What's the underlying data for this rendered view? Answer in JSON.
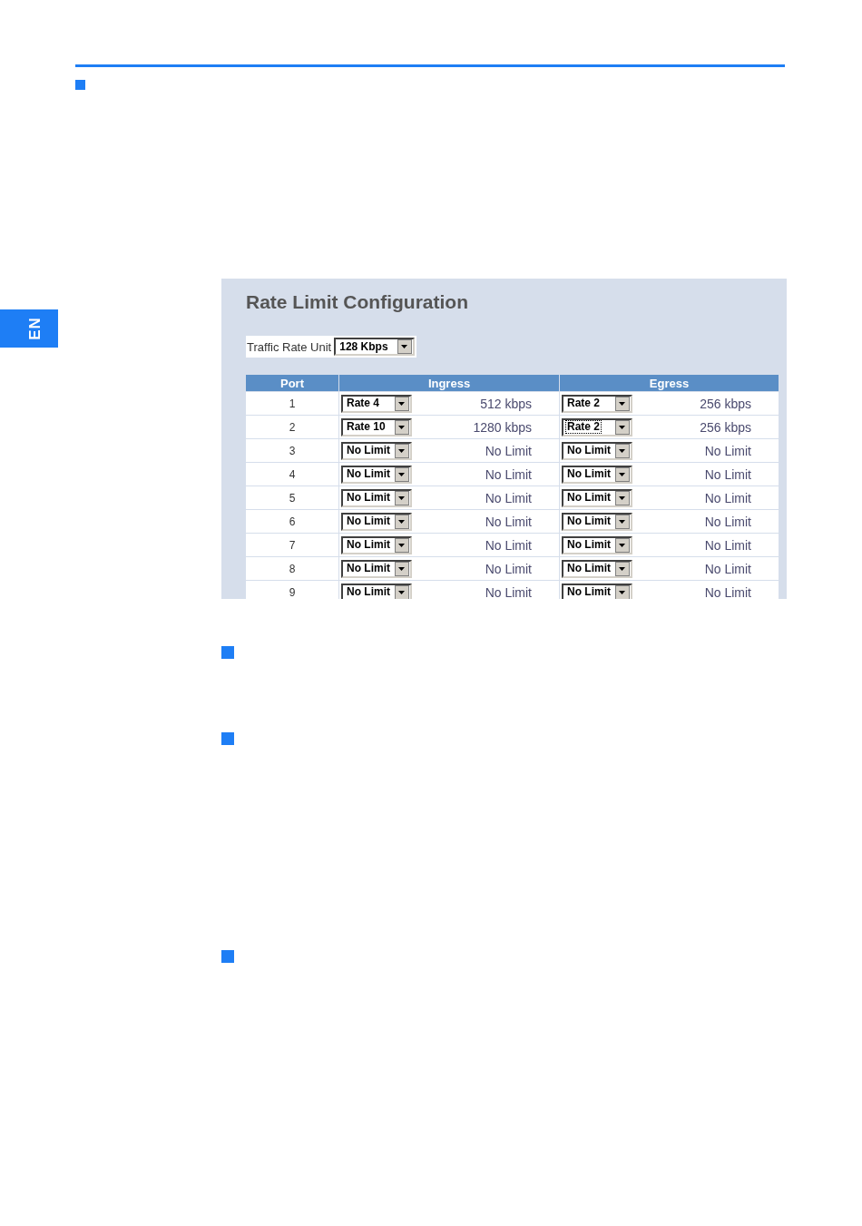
{
  "side_tab": {
    "label": "EN"
  },
  "panel": {
    "title": "Rate Limit Configuration",
    "unit": {
      "label": "Traffic Rate Unit",
      "value": "128 Kbps"
    },
    "columns": [
      "Port",
      "Ingress",
      "Egress"
    ],
    "rows": [
      {
        "port": "1",
        "ingress": {
          "value": "Rate 4",
          "reading": "512 kbps",
          "focused": false
        },
        "egress": {
          "value": "Rate 2",
          "reading": "256 kbps",
          "focused": false
        }
      },
      {
        "port": "2",
        "ingress": {
          "value": "Rate 10",
          "reading": "1280 kbps",
          "focused": false
        },
        "egress": {
          "value": "Rate 2",
          "reading": "256 kbps",
          "focused": true
        }
      },
      {
        "port": "3",
        "ingress": {
          "value": "No Limit",
          "reading": "No Limit",
          "focused": false
        },
        "egress": {
          "value": "No Limit",
          "reading": "No Limit",
          "focused": false
        }
      },
      {
        "port": "4",
        "ingress": {
          "value": "No Limit",
          "reading": "No Limit",
          "focused": false
        },
        "egress": {
          "value": "No Limit",
          "reading": "No Limit",
          "focused": false
        }
      },
      {
        "port": "5",
        "ingress": {
          "value": "No Limit",
          "reading": "No Limit",
          "focused": false
        },
        "egress": {
          "value": "No Limit",
          "reading": "No Limit",
          "focused": false
        }
      },
      {
        "port": "6",
        "ingress": {
          "value": "No Limit",
          "reading": "No Limit",
          "focused": false
        },
        "egress": {
          "value": "No Limit",
          "reading": "No Limit",
          "focused": false
        }
      },
      {
        "port": "7",
        "ingress": {
          "value": "No Limit",
          "reading": "No Limit",
          "focused": false
        },
        "egress": {
          "value": "No Limit",
          "reading": "No Limit",
          "focused": false
        }
      },
      {
        "port": "8",
        "ingress": {
          "value": "No Limit",
          "reading": "No Limit",
          "focused": false
        },
        "egress": {
          "value": "No Limit",
          "reading": "No Limit",
          "focused": false
        }
      },
      {
        "port": "9",
        "ingress": {
          "value": "No Limit",
          "reading": "No Limit",
          "focused": false
        },
        "egress": {
          "value": "No Limit",
          "reading": "No Limit",
          "focused": false
        }
      }
    ]
  }
}
